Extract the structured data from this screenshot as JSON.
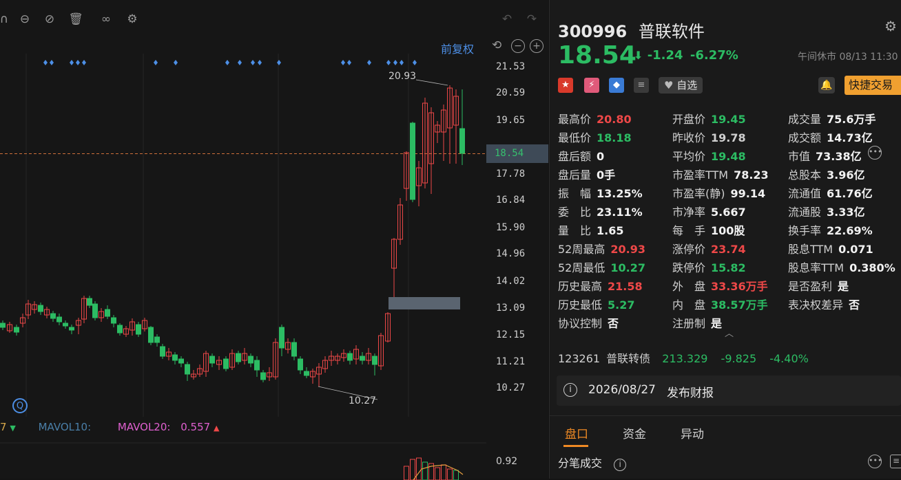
{
  "chart": {
    "adjust_label": "前复权",
    "y_ticks": [
      "21.53",
      "20.59",
      "19.65",
      "18.54",
      "17.78",
      "16.84",
      "15.90",
      "14.96",
      "14.02",
      "13.09",
      "12.15",
      "11.21",
      "10.27"
    ],
    "high_annotation": "20.93",
    "low_annotation": "10.27",
    "current_price_tag": "18.54",
    "volume_tick": "0.92",
    "ma_legend": {
      "partial_left": "7",
      "mavol10_label": "MAVOL10:",
      "mavol20_label": "MAVOL20:",
      "mavol20_value": "0.557"
    },
    "colors": {
      "up": "#ef4848",
      "down": "#2cbc63",
      "marker": "#4d8fe6"
    }
  },
  "quote": {
    "code": "300996",
    "name": "普联软件",
    "price": "18.54",
    "arrow": "⬇",
    "change": "-1.24",
    "change_pct": "-6.27%",
    "status": "午间休市 08/13 11:30",
    "watch_label": "自选",
    "quick_trade_label": "快捷交易"
  },
  "stats": [
    [
      {
        "label": "最高价",
        "value": "20.80",
        "color": "red"
      },
      {
        "label": "开盘价",
        "value": "19.45",
        "color": "green"
      },
      {
        "label": "成交量",
        "value": "75.6万手",
        "color": "white"
      }
    ],
    [
      {
        "label": "最低价",
        "value": "18.18",
        "color": "green"
      },
      {
        "label": "昨收价",
        "value": "19.78",
        "color": "gray"
      },
      {
        "label": "成交额",
        "value": "14.73亿",
        "color": "white"
      }
    ],
    [
      {
        "label": "盘后额",
        "value": "0",
        "color": "white"
      },
      {
        "label": "平均价",
        "value": "19.48",
        "color": "green"
      },
      {
        "label": "市值",
        "value": "73.38亿",
        "color": "white"
      }
    ],
    [
      {
        "label": "盘后量",
        "value": "0手",
        "color": "white"
      },
      {
        "label": "市盈率TTM",
        "value": "78.23",
        "color": "white"
      },
      {
        "label": "总股本",
        "value": "3.96亿",
        "color": "white"
      }
    ],
    [
      {
        "label": "振　幅",
        "value": "13.25%",
        "color": "white"
      },
      {
        "label": "市盈率(静)",
        "value": "99.14",
        "color": "white"
      },
      {
        "label": "流通值",
        "value": "61.76亿",
        "color": "white"
      }
    ],
    [
      {
        "label": "委　比",
        "value": "23.11%",
        "color": "white"
      },
      {
        "label": "市净率",
        "value": "5.667",
        "color": "white"
      },
      {
        "label": "流通股",
        "value": "3.33亿",
        "color": "white"
      }
    ],
    [
      {
        "label": "量　比",
        "value": "1.65",
        "color": "white"
      },
      {
        "label": "每　手",
        "value": "100股",
        "color": "white"
      },
      {
        "label": "换手率",
        "value": "22.69%",
        "color": "white"
      }
    ],
    [
      {
        "label": "52周最高",
        "value": "20.93",
        "color": "red"
      },
      {
        "label": "涨停价",
        "value": "23.74",
        "color": "red"
      },
      {
        "label": "股息TTM",
        "value": "0.071",
        "color": "white"
      }
    ],
    [
      {
        "label": "52周最低",
        "value": "10.27",
        "color": "green"
      },
      {
        "label": "跌停价",
        "value": "15.82",
        "color": "green"
      },
      {
        "label": "股息率TTM",
        "value": "0.380%",
        "color": "white"
      }
    ],
    [
      {
        "label": "历史最高",
        "value": "21.58",
        "color": "red"
      },
      {
        "label": "外　盘",
        "value": "33.36万手",
        "color": "red"
      },
      {
        "label": "是否盈利",
        "value": "是",
        "color": "white"
      }
    ],
    [
      {
        "label": "历史最低",
        "value": "5.27",
        "color": "green"
      },
      {
        "label": "内　盘",
        "value": "38.57万手",
        "color": "green"
      },
      {
        "label": "表决权差异",
        "value": "否",
        "color": "white"
      }
    ],
    [
      {
        "label": "协议控制",
        "value": "否",
        "color": "white"
      },
      {
        "label": "注册制",
        "value": "是",
        "color": "white"
      },
      null
    ]
  ],
  "bond": {
    "code": "123261",
    "name": "普联转债",
    "price": "213.329",
    "change": "-9.825",
    "change_pct": "-4.40%"
  },
  "report": {
    "date": "2026/08/27",
    "text": "发布财报"
  },
  "tabs": [
    "盘口",
    "资金",
    "异动"
  ],
  "ticks_title": "分笔成交"
}
